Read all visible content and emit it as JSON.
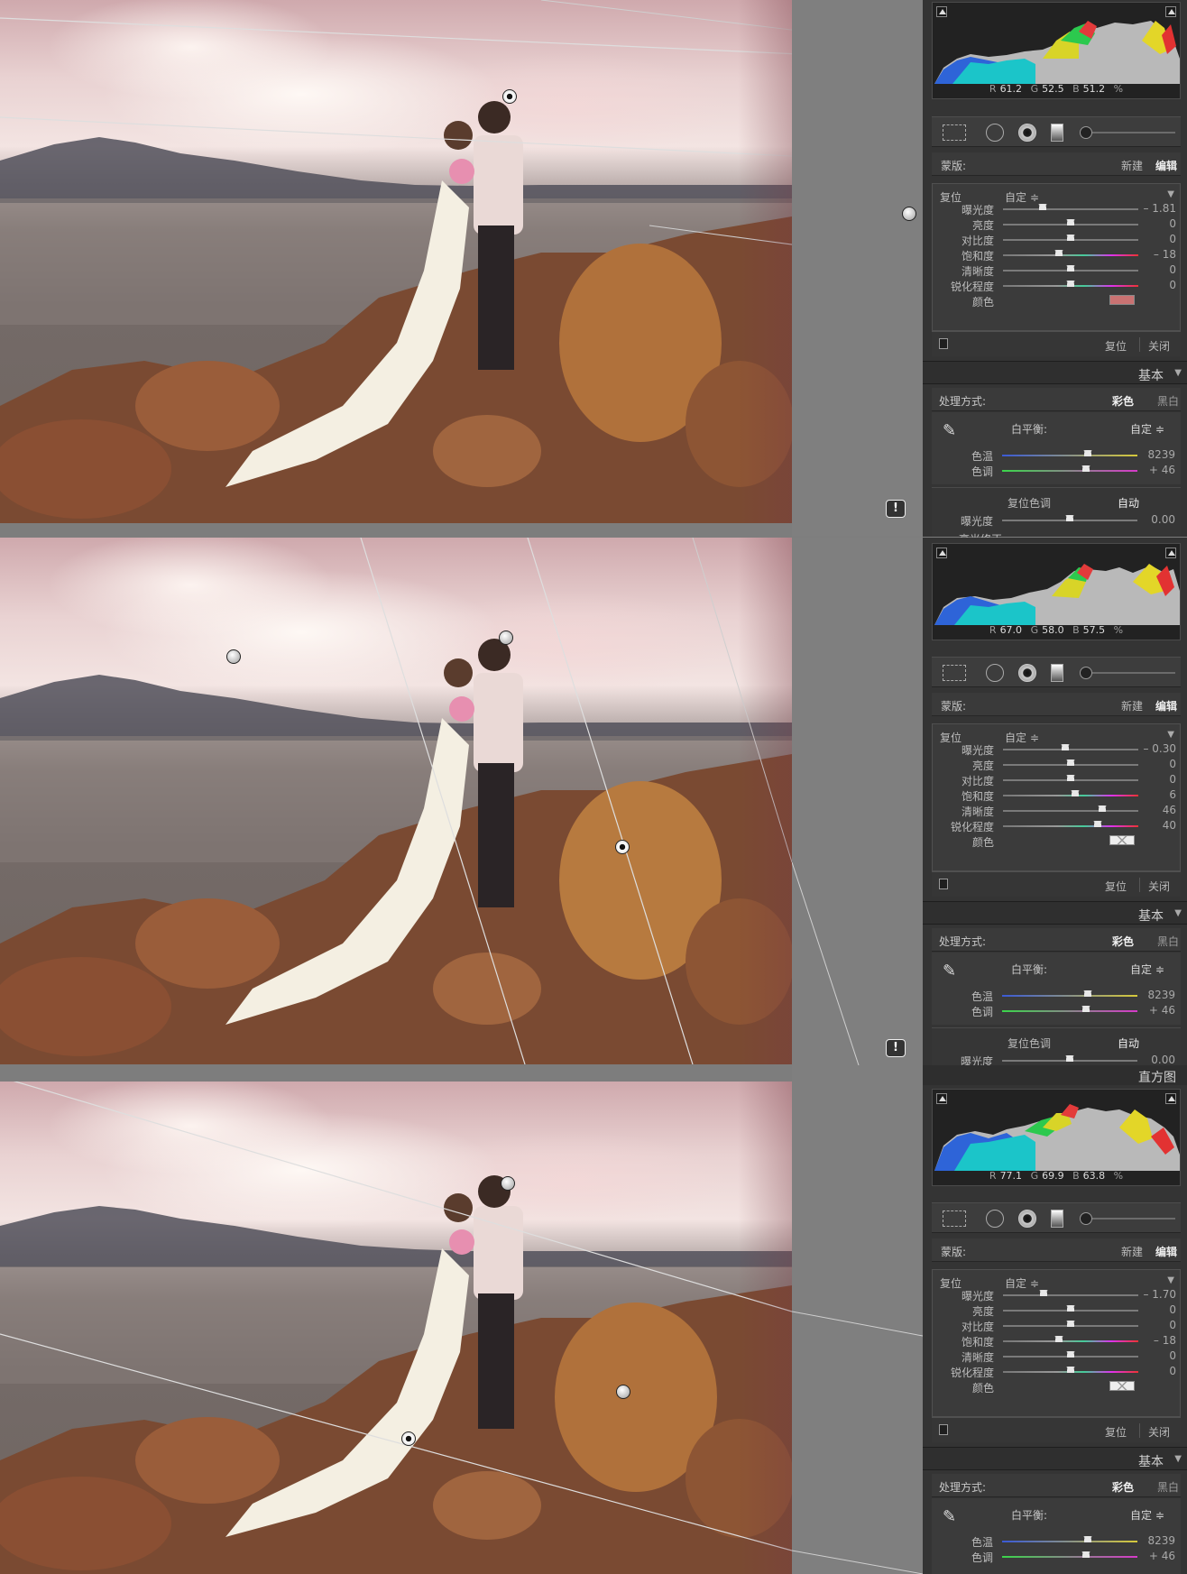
{
  "views": [
    {
      "rgb": {
        "r_label": "R",
        "r": "61.2",
        "g_label": "G",
        "g": "52.5",
        "b_label": "B",
        "b": "51.2",
        "unit": "%"
      },
      "mask": {
        "label": "蒙版:",
        "new": "新建",
        "edit": "编辑"
      },
      "adjust": {
        "reset": "复位",
        "preset": "自定 ≑",
        "sliders": [
          {
            "name": "曝光度",
            "value": "– 1.81",
            "pos": 0.29,
            "track": "plain"
          },
          {
            "name": "亮度",
            "value": "0",
            "pos": 0.5,
            "track": "plain"
          },
          {
            "name": "对比度",
            "value": "0",
            "pos": 0.5,
            "track": "plain"
          },
          {
            "name": "饱和度",
            "value": "– 18",
            "pos": 0.41,
            "track": "sat"
          },
          {
            "name": "清晰度",
            "value": "0",
            "pos": 0.5,
            "track": "plain"
          },
          {
            "name": "锐化程度",
            "value": "0",
            "pos": 0.5,
            "track": "sat"
          }
        ],
        "color_label": "颜色",
        "color_swatch": "#c97272"
      },
      "footer": {
        "reset": "复位",
        "close": "关闭"
      },
      "section": "基本",
      "process": {
        "label": "处理方式:",
        "color": "彩色",
        "bw": "黑白"
      },
      "wb": {
        "label": "白平衡:",
        "value": "自定 ≑",
        "temp": {
          "name": "色温",
          "value": "8239",
          "pos": 0.63
        },
        "tint": {
          "name": "色调",
          "value": "+ 46",
          "pos": 0.62
        }
      },
      "tone": {
        "label": "复位色调",
        "auto": "自动"
      },
      "exposure_row": {
        "name": "曝光度",
        "value": "0.00",
        "pos": 0.5
      },
      "partial_row": "高光修正",
      "warn": "!"
    },
    {
      "rgb": {
        "r_label": "R",
        "r": "67.0",
        "g_label": "G",
        "g": "58.0",
        "b_label": "B",
        "b": "57.5",
        "unit": "%"
      },
      "mask": {
        "label": "蒙版:",
        "new": "新建",
        "edit": "编辑"
      },
      "adjust": {
        "reset": "复位",
        "preset": "自定 ≑",
        "sliders": [
          {
            "name": "曝光度",
            "value": "– 0.30",
            "pos": 0.46,
            "track": "plain"
          },
          {
            "name": "亮度",
            "value": "0",
            "pos": 0.5,
            "track": "plain"
          },
          {
            "name": "对比度",
            "value": "0",
            "pos": 0.5,
            "track": "plain"
          },
          {
            "name": "饱和度",
            "value": "6",
            "pos": 0.53,
            "track": "sat"
          },
          {
            "name": "清晰度",
            "value": "46",
            "pos": 0.73,
            "track": "plain"
          },
          {
            "name": "锐化程度",
            "value": "40",
            "pos": 0.7,
            "track": "sat"
          }
        ],
        "color_label": "颜色",
        "color_swatch": "none"
      },
      "footer": {
        "reset": "复位",
        "close": "关闭"
      },
      "section": "基本",
      "process": {
        "label": "处理方式:",
        "color": "彩色",
        "bw": "黑白"
      },
      "wb": {
        "label": "白平衡:",
        "value": "自定 ≑",
        "temp": {
          "name": "色温",
          "value": "8239",
          "pos": 0.63
        },
        "tint": {
          "name": "色调",
          "value": "+ 46",
          "pos": 0.62
        }
      },
      "tone": {
        "label": "复位色调",
        "auto": "自动"
      },
      "exposure_row": {
        "name": "曝光度",
        "value": "0.00",
        "pos": 0.5
      },
      "warn": "!"
    },
    {
      "title": "直方图",
      "rgb": {
        "r_label": "R",
        "r": "77.1",
        "g_label": "G",
        "g": "69.9",
        "b_label": "B",
        "b": "63.8",
        "unit": "%"
      },
      "mask": {
        "label": "蒙版:",
        "new": "新建",
        "edit": "编辑"
      },
      "adjust": {
        "reset": "复位",
        "preset": "自定 ≑",
        "sliders": [
          {
            "name": "曝光度",
            "value": "– 1.70",
            "pos": 0.3,
            "track": "plain"
          },
          {
            "name": "亮度",
            "value": "0",
            "pos": 0.5,
            "track": "plain"
          },
          {
            "name": "对比度",
            "value": "0",
            "pos": 0.5,
            "track": "plain"
          },
          {
            "name": "饱和度",
            "value": "– 18",
            "pos": 0.41,
            "track": "sat"
          },
          {
            "name": "清晰度",
            "value": "0",
            "pos": 0.5,
            "track": "plain"
          },
          {
            "name": "锐化程度",
            "value": "0",
            "pos": 0.5,
            "track": "sat"
          }
        ],
        "color_label": "颜色",
        "color_swatch": "none"
      },
      "footer": {
        "reset": "复位",
        "close": "关闭"
      },
      "section": "基本",
      "process": {
        "label": "处理方式:",
        "color": "彩色",
        "bw": "黑白"
      },
      "wb": {
        "label": "白平衡:",
        "value": "自定 ≑",
        "temp": {
          "name": "色温",
          "value": "8239",
          "pos": 0.63
        },
        "tint": {
          "name": "色调",
          "value": "+ 46",
          "pos": 0.62
        }
      }
    }
  ]
}
